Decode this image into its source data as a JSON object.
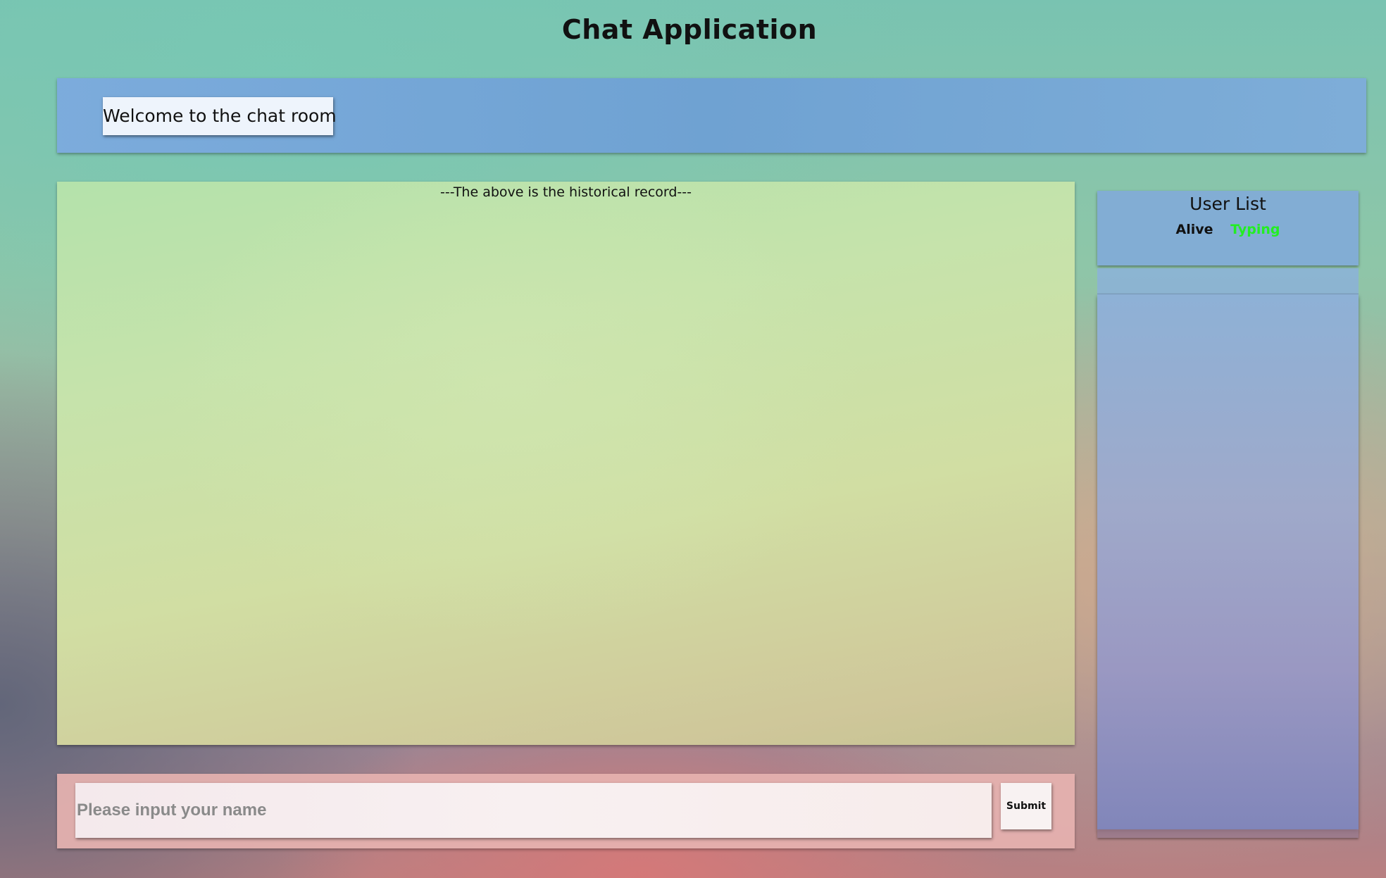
{
  "header": {
    "title": "Chat Application"
  },
  "welcome": {
    "text": "Welcome to the chat room"
  },
  "chat": {
    "history_note": "---The above is the historical record---"
  },
  "composer": {
    "name_placeholder": "Please input your name",
    "name_value": "",
    "submit_label": "Submit"
  },
  "user_list": {
    "title": "User List",
    "legend": {
      "alive_label": "Alive",
      "typing_label": "Typing",
      "typing_color": "#22ee22"
    },
    "users": []
  }
}
